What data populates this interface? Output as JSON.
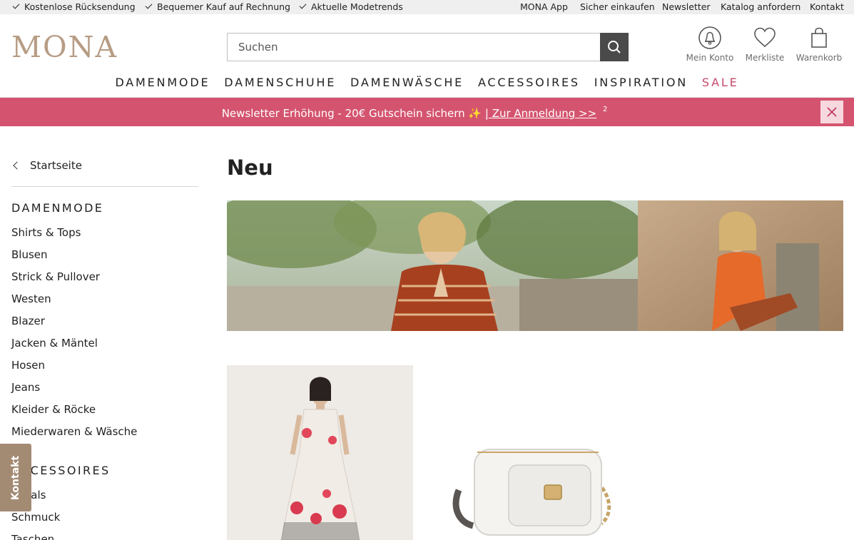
{
  "topbar": {
    "usps": [
      "Kostenlose Rücksendung",
      "Bequemer Kauf auf Rechnung",
      "Aktuelle Modetrends"
    ],
    "links": [
      "MONA App",
      "Sicher einkaufen",
      "Newsletter",
      "Katalog anfordern",
      "Kontakt"
    ]
  },
  "header": {
    "logo": "MONA",
    "search_placeholder": "Suchen",
    "account_label": "Mein Konto",
    "wishlist_label": "Merkliste",
    "cart_label": "Warenkorb"
  },
  "nav": {
    "items": [
      "DAMENMODE",
      "DAMENSCHUHE",
      "DAMENWÄSCHE",
      "ACCESSOIRES",
      "INSPIRATION",
      "SALE"
    ]
  },
  "promo": {
    "text": "Newsletter Erhöhung - 20€ Gutschein sichern",
    "sparkle": "✨",
    "link": "| Zur Anmeldung >>",
    "sup": "2"
  },
  "sidebar": {
    "back_label": "Startseite",
    "section1": {
      "title": "DAMENMODE",
      "items": [
        "Shirts & Tops",
        "Blusen",
        "Strick & Pullover",
        "Westen",
        "Blazer",
        "Jacken & Mäntel",
        "Hosen",
        "Jeans",
        "Kleider & Röcke",
        "Miederwaren & Wäsche"
      ]
    },
    "section2": {
      "title": "ACCESSOIRES",
      "items": [
        "Schals",
        "Schmuck",
        "Taschen"
      ]
    },
    "kontakt_tab": "Kontakt"
  },
  "main": {
    "title": "Neu"
  },
  "colors": {
    "accent": "#b79c84",
    "promo": "#d4546f",
    "sale": "#c74869",
    "kontakt_tab": "#a38a73"
  }
}
